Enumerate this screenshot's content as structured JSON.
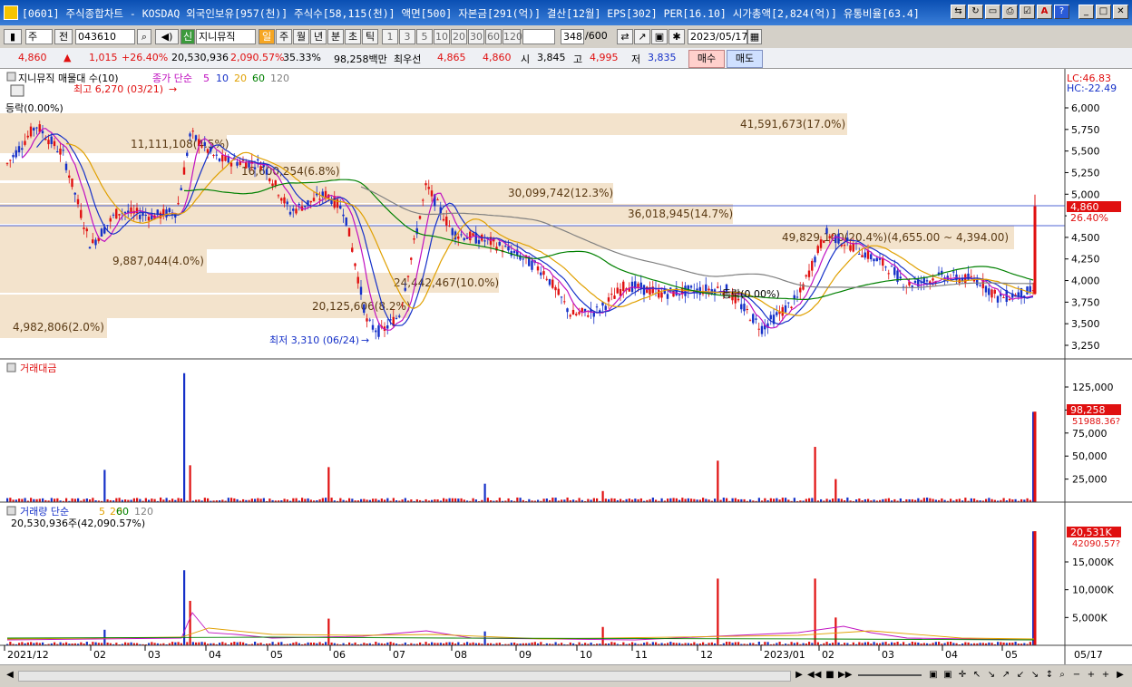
{
  "window": {
    "title": "[0601] 주식종합차트 - KOSDAQ 외국인보유[957(천)] 주식수[58,115(천)] 액면[500] 자본금[291(억)] 결산[12월] EPS[302] PER[16.10] 시가총액[2,824(억)] 유통비율[63.4]"
  },
  "toolbar": {
    "period_select": "주",
    "prev_label": "전",
    "stock_code": "043610",
    "stock_name": "지니뮤직",
    "periods": [
      "일",
      "주",
      "월",
      "년",
      "분",
      "초",
      "틱"
    ],
    "active_period": "일",
    "intervals": [
      "1",
      "3",
      "5",
      "10",
      "20",
      "30",
      "60",
      "120"
    ],
    "count": "348",
    "count_total": "/600",
    "date": "2023/05/17"
  },
  "info": {
    "price": "4,860",
    "change": "1,015",
    "change_pct": "+26.40%",
    "volume": "20,530,936",
    "volume_pct": "2,090.57%",
    "turnover": "35.33%",
    "amount": "98,258백만",
    "best_bid_label": "최우선",
    "best_ask": "4,865",
    "best_bid": "4,860",
    "open_label": "시",
    "open": "3,845",
    "high_label": "고",
    "high": "4,995",
    "low_label": "저",
    "low": "3,835",
    "buy": "매수",
    "sell": "매도"
  },
  "price_panel": {
    "legend_title": "지니뮤직 매물대 수(10)",
    "ma_label": "종가 단순",
    "ma_periods": [
      "5",
      "10",
      "20",
      "60",
      "120"
    ],
    "lc": "LC:46.83",
    "hc": "HC:-22.49",
    "high_marker": "최고 6,270 (03/21)",
    "low_marker": "최저 3,310 (06/24)",
    "drop_note": "등락(0.00%)",
    "drop_note2": "등락(0.00%)",
    "current_price_tag": "4,860",
    "current_pct_tag": "26.40%",
    "y_ticks": [
      "6,000",
      "5,750",
      "5,500",
      "5,250",
      "5,000",
      "4,750",
      "4,500",
      "4,250",
      "4,000",
      "3,750",
      "3,500",
      "3,250"
    ],
    "volume_profile": [
      {
        "label": "41,591,673(17.0%)"
      },
      {
        "label": "11,111,108(4.5%)"
      },
      {
        "label": "16,600,254(6.8%)"
      },
      {
        "label": "30,099,742(12.3%)"
      },
      {
        "label": "36,018,945(14.7%)"
      },
      {
        "label": "49,829,100(20.4%)(4,655.00 ~ 4,394.00)"
      },
      {
        "label": "9,887,044(4.0%)"
      },
      {
        "label": "24,442,467(10.0%)"
      },
      {
        "label": "20,125,606(8.2%)"
      },
      {
        "label": "4,982,806(2.0%)"
      }
    ]
  },
  "amount_panel": {
    "title": "거래대금",
    "y_ticks": [
      "125,000",
      "100,000",
      "75,000",
      "50,000",
      "25,000"
    ],
    "current_tag": "98,258",
    "ma_tag": "51988.36?"
  },
  "volume_panel": {
    "title": "거래량 단순",
    "ma_periods": [
      "5",
      "20",
      "60",
      "120"
    ],
    "current_text": "20,530,936주(42,090.57%)",
    "y_ticks": [
      "15,000K",
      "10,000K",
      "5,000K"
    ],
    "current_tag": "20,531K",
    "pct_tag": "42090.57?"
  },
  "x_axis": {
    "labels": [
      "2021/12",
      "02",
      "03",
      "04",
      "05",
      "06",
      "07",
      "08",
      "09",
      "10",
      "11",
      "12",
      "2023/01",
      "02",
      "03",
      "04",
      "05"
    ],
    "right_label": "05/17"
  },
  "colors": {
    "up": "#e01010",
    "down": "#1530c8",
    "ma5": "#c010c0",
    "ma10": "#1530c8",
    "ma20": "#e0a000",
    "ma60": "#008000",
    "ma120": "#808080",
    "profile": "#f3e3cc"
  }
}
